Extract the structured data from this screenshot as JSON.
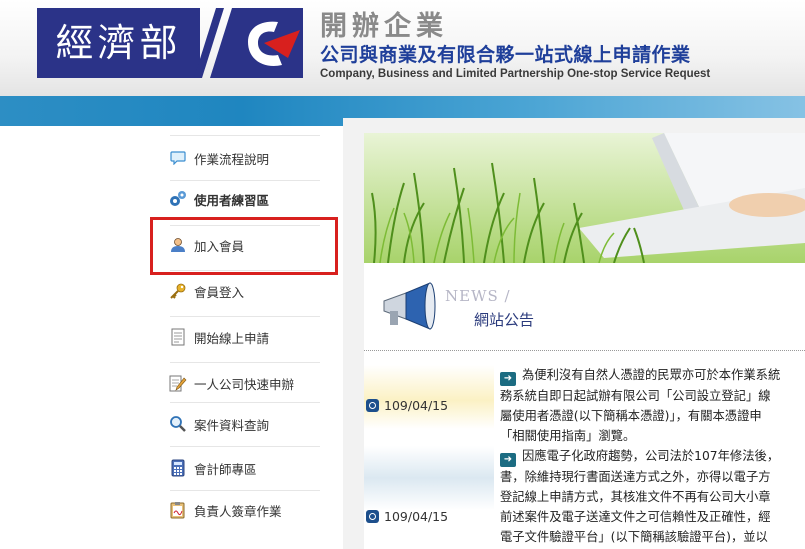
{
  "header": {
    "logo_text": "經濟部",
    "title": "開辦企業",
    "subtitle": "公司與商業及有限合夥一站式線上申請作業",
    "subtitle_en": "Company, Business and Limited Partnership One-stop Service Request"
  },
  "sidebar": {
    "items": [
      {
        "label": "作業流程說明",
        "icon": "chat-bubble-icon"
      },
      {
        "label": "使用者練習區",
        "icon": "gears-icon"
      },
      {
        "label": "加入會員",
        "icon": "user-icon"
      },
      {
        "label": "會員登入",
        "icon": "key-icon"
      },
      {
        "label": "開始線上申請",
        "icon": "document-icon"
      },
      {
        "label": "一人公司快速申辦",
        "icon": "edit-form-icon"
      },
      {
        "label": "案件資料查詢",
        "icon": "magnifier-icon"
      },
      {
        "label": "會計師專區",
        "icon": "calculator-icon"
      },
      {
        "label": "負責人簽章作業",
        "icon": "clipboard-sign-icon"
      }
    ]
  },
  "news": {
    "heading_en": "NEWS /",
    "heading_zh": "網站公告",
    "items": [
      {
        "date": "109/04/15",
        "lines": [
          "為便利沒有自然人憑證的民眾亦可於本作業系統",
          "務系統自即日起試辦有限公司「公司設立登記」線",
          "屬使用者憑證(以下簡稱本憑證)」，有關本憑證申",
          "「相關使用指南」瀏覽。"
        ]
      },
      {
        "date": "109/04/15",
        "lines": [
          "因應電子化政府趨勢，公司法於107年修法後，",
          "書，除維持現行書面送達方式之外，亦得以電子方",
          "登記線上申請方式，其核准文件不再有公司大小章",
          "前述案件及電子送達文件之可信賴性及正確性，經",
          "電子文件驗證平台」(以下簡稱該驗證平台)，並以"
        ]
      }
    ]
  },
  "colors": {
    "logo_bg": "#2b3388",
    "accent_red": "#d8201e",
    "blue_bar": "#1f86c0",
    "subtitle_blue": "#1f3f9a"
  }
}
